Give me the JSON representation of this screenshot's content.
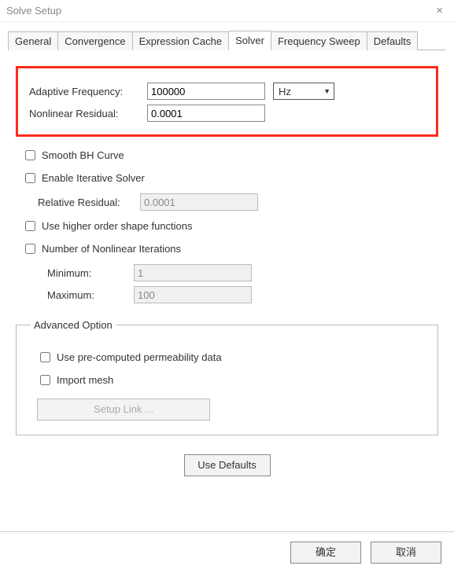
{
  "window": {
    "title": "Solve Setup",
    "close": "×"
  },
  "tabs": {
    "general": "General",
    "convergence": "Convergence",
    "expression_cache": "Expression Cache",
    "solver": "Solver",
    "frequency_sweep": "Frequency Sweep",
    "defaults": "Defaults"
  },
  "solver": {
    "adaptive_freq_label": "Adaptive Frequency:",
    "adaptive_freq_value": "100000",
    "adaptive_freq_unit": "Hz",
    "nonlinear_resid_label": "Nonlinear Residual:",
    "nonlinear_resid_value": "0.0001",
    "smooth_bh_label": "Smooth BH Curve",
    "enable_iter_label": "Enable Iterative Solver",
    "relative_resid_label": "Relative Residual:",
    "relative_resid_value": "0.0001",
    "higher_order_label": "Use higher order shape functions",
    "num_nonlinear_label": "Number of Nonlinear Iterations",
    "minimum_label": "Minimum:",
    "minimum_value": "1",
    "maximum_label": "Maximum:",
    "maximum_value": "100"
  },
  "advanced": {
    "legend": "Advanced Option",
    "precomputed_label": "Use pre-computed permeability data",
    "import_mesh_label": "Import mesh",
    "setup_link_label": "Setup Link ..."
  },
  "use_defaults_label": "Use Defaults",
  "footer": {
    "ok": "确定",
    "cancel": "取消"
  }
}
